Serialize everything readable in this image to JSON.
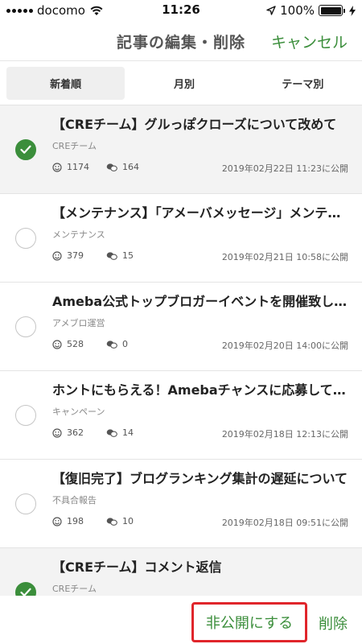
{
  "status_bar": {
    "carrier": "docomo",
    "time": "11:26",
    "battery": "100%",
    "icons": [
      "signal-dots-icon",
      "wifi-icon",
      "location-icon",
      "battery-icon",
      "charging-icon"
    ]
  },
  "nav": {
    "title": "記事の編集・削除",
    "cancel_label": "キャンセル"
  },
  "tabs": [
    {
      "label": "新着順",
      "active": true
    },
    {
      "label": "月別",
      "active": false
    },
    {
      "label": "テーマ別",
      "active": false
    }
  ],
  "articles": [
    {
      "title": "【CREチーム】グルっぽクローズについて改めて",
      "theme": "CREチーム",
      "likes": "1174",
      "comments": "164",
      "date": "2019年02月22日 11:23に公開",
      "selected": true
    },
    {
      "title": "【メンテナンス】「アメーバメッセージ」メンテ…",
      "theme": "メンテナンス",
      "likes": "379",
      "comments": "15",
      "date": "2019年02月21日 10:58に公開",
      "selected": false
    },
    {
      "title": "Ameba公式トップブロガーイベントを開催致し…",
      "theme": "アメブロ運営",
      "likes": "528",
      "comments": "0",
      "date": "2019年02月20日 14:00に公開",
      "selected": false
    },
    {
      "title": "ホントにもらえる！Amebaチャンスに応募して…",
      "theme": "キャンペーン",
      "likes": "362",
      "comments": "14",
      "date": "2019年02月18日 12:13に公開",
      "selected": false
    },
    {
      "title": "【復旧完了】ブログランキング集計の遅延について",
      "theme": "不具合報告",
      "likes": "198",
      "comments": "10",
      "date": "2019年02月18日 09:51に公開",
      "selected": false
    },
    {
      "title": "【CREチーム】コメント返信",
      "theme": "CREチーム",
      "likes": "",
      "comments": "",
      "date": "",
      "selected": true
    }
  ],
  "actions": {
    "private_label": "非公開にする",
    "delete_label": "削除"
  },
  "colors": {
    "accent": "#3b8e3b",
    "highlight_border": "#e0252b",
    "selected_row_bg": "#f3f3f3"
  }
}
